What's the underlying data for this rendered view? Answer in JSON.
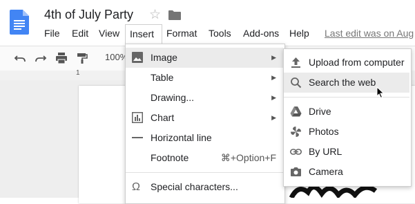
{
  "document": {
    "title": "4th of July Party",
    "last_edit": "Last edit was on Aug",
    "zoom": "100%",
    "ruler_mark": "1"
  },
  "menubar": {
    "items": [
      "File",
      "Edit",
      "View",
      "Insert",
      "Format",
      "Tools",
      "Add-ons",
      "Help"
    ],
    "open_item": "Insert"
  },
  "insert_menu": {
    "items": [
      {
        "label": "Image",
        "icon": "image-icon",
        "has_submenu": true,
        "highlighted": true
      },
      {
        "label": "Table",
        "has_submenu": true
      },
      {
        "label": "Drawing...",
        "has_submenu": true
      },
      {
        "label": "Chart",
        "icon": "chart-icon",
        "has_submenu": true
      },
      {
        "label": "Horizontal line",
        "icon": "horizontal-line-icon"
      },
      {
        "label": "Footnote",
        "shortcut": "⌘+Option+F"
      },
      {
        "label": "Special characters...",
        "icon": "omega-icon"
      }
    ]
  },
  "image_submenu": {
    "items": [
      {
        "label": "Upload from computer",
        "icon": "upload-icon"
      },
      {
        "label": "Search the web",
        "icon": "search-icon",
        "highlighted": true
      },
      {
        "label": "Drive",
        "icon": "drive-icon"
      },
      {
        "label": "Photos",
        "icon": "photos-icon"
      },
      {
        "label": "By URL",
        "icon": "link-icon"
      },
      {
        "label": "Camera",
        "icon": "camera-icon"
      }
    ]
  },
  "colors": {
    "docs_blue": "#4285f4",
    "highlight": "#ebebeb"
  }
}
